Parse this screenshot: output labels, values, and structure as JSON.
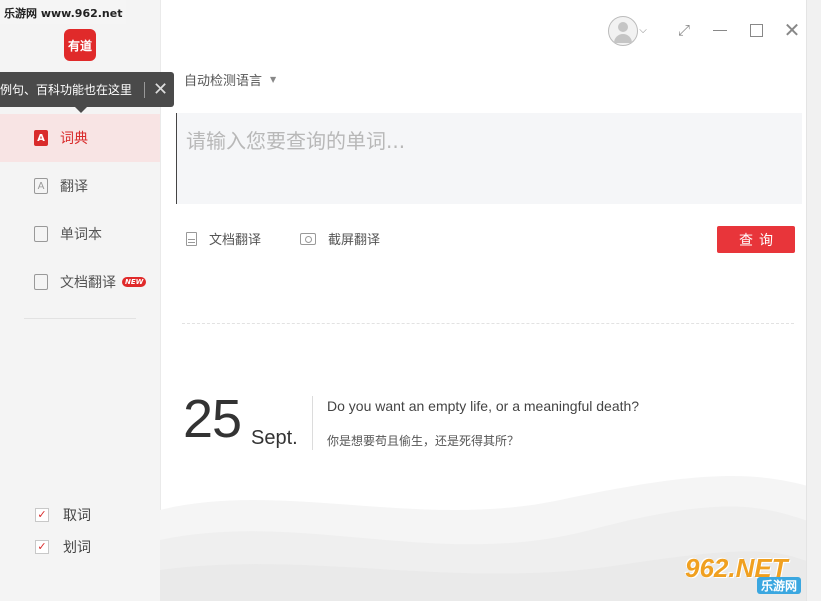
{
  "watermark": {
    "top": "乐游网 www.962.net",
    "bottom_big": "962.NET",
    "bottom_small": "乐游网"
  },
  "app": {
    "logo_text": "有道",
    "accent_color": "#e02a2a"
  },
  "tooltip": {
    "text": "例句、百科功能也在这里",
    "close": "✕"
  },
  "sidebar": {
    "items": [
      {
        "label": "词典",
        "icon": "A",
        "active": true
      },
      {
        "label": "翻译",
        "icon": "A",
        "active": false
      },
      {
        "label": "单词本",
        "icon": "",
        "active": false
      },
      {
        "label": "文档翻译",
        "icon": "",
        "active": false,
        "badge": "NEW"
      }
    ],
    "checks": [
      {
        "label": "取词",
        "checked": true
      },
      {
        "label": "划词",
        "checked": true
      }
    ]
  },
  "window": {
    "caret": "⌵",
    "pin": "⤢",
    "close": "✕"
  },
  "main": {
    "language_select": "自动检测语言",
    "language_caret": "▼",
    "query_placeholder": "请输入您要查询的单词...",
    "query_value": "",
    "doc_translate": "文档翻译",
    "screen_translate": "截屏翻译",
    "search_button": "查询"
  },
  "daily": {
    "day": "25",
    "month": "Sept.",
    "quote_en": "Do you want an empty life, or a meaningful death?",
    "quote_zh": "你是想要苟且偷生，还是死得其所？"
  }
}
